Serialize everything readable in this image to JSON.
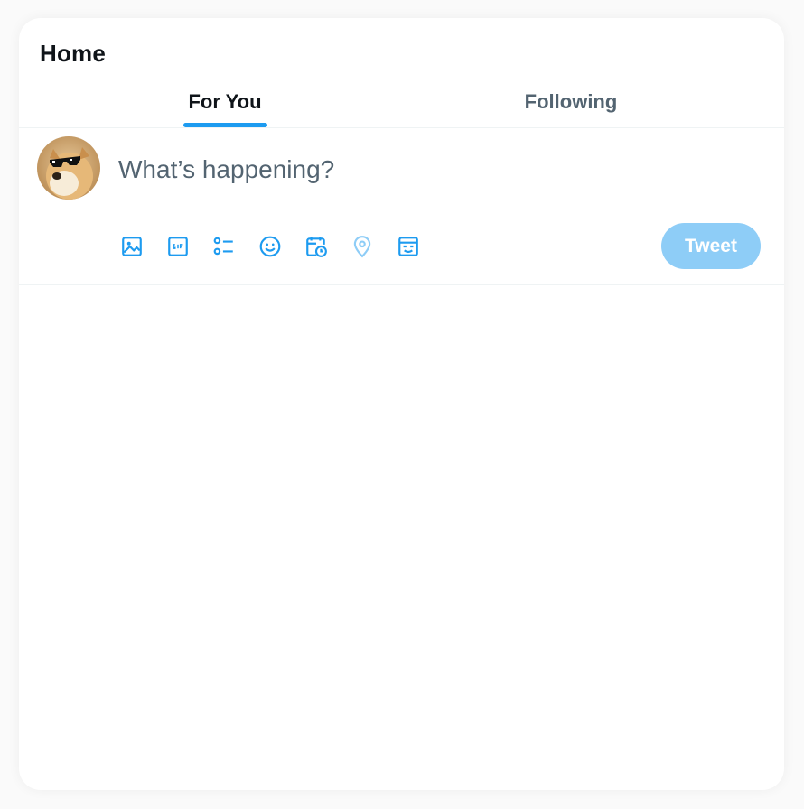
{
  "header": {
    "title": "Home"
  },
  "tabs": [
    {
      "label": "For You",
      "active": true
    },
    {
      "label": "Following",
      "active": false
    }
  ],
  "composer": {
    "placeholder": "What’s happening?",
    "avatar_icon": "doge-sunglasses-avatar",
    "tools": [
      {
        "icon": "image-icon"
      },
      {
        "icon": "gif-icon"
      },
      {
        "icon": "poll-icon"
      },
      {
        "icon": "emoji-icon"
      },
      {
        "icon": "schedule-icon"
      },
      {
        "icon": "location-icon"
      },
      {
        "icon": "tag-icon"
      }
    ],
    "submit_label": "Tweet"
  },
  "colors": {
    "accent": "#1d9bf0",
    "tweet_button_disabled": "#8ecdf7",
    "text_primary": "#0f1419",
    "text_secondary": "#536471"
  }
}
